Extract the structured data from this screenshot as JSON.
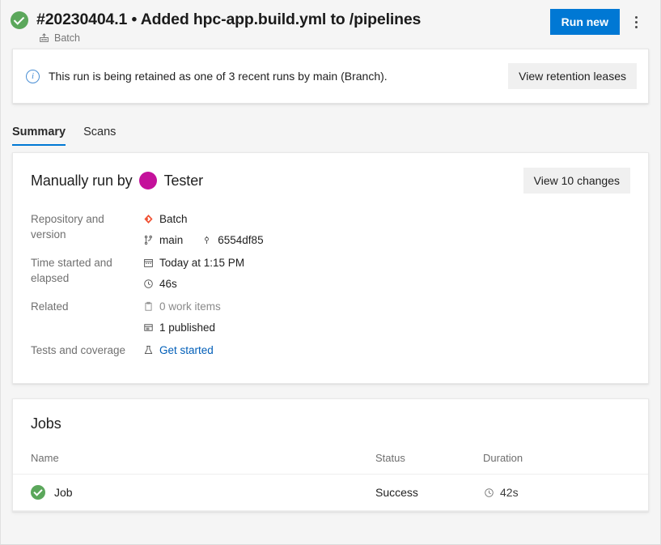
{
  "header": {
    "status_icon": "success-check-icon",
    "title": "#20230404.1 • Added hpc-app.build.yml to /pipelines",
    "pipeline_icon": "pipeline-icon",
    "pipeline_name": "Batch",
    "run_new_label": "Run new",
    "more_actions_icon": "kebab-menu-icon",
    "accent_color": "#0078d4",
    "success_color": "#5ba75b"
  },
  "banner": {
    "icon": "info-icon",
    "message": "This run is being retained as one of 3 recent runs by main (Branch).",
    "action_label": "View retention leases"
  },
  "tabs": [
    {
      "label": "Summary",
      "active": true
    },
    {
      "label": "Scans",
      "active": false
    }
  ],
  "summary": {
    "run_by_prefix": "Manually run by",
    "avatar_icon": "user-avatar",
    "avatar_color": "#c4119b",
    "user_name": "Tester",
    "changes_button_label": "View 10 changes",
    "details": {
      "repository_label": "Repository and version",
      "repository_icon": "azure-repos-icon",
      "repository_name": "Batch",
      "branch_icon": "branch-icon",
      "branch_name": "main",
      "commit_icon": "commit-icon",
      "commit_sha": "6554df85",
      "time_label": "Time started and elapsed",
      "calendar_icon": "calendar-icon",
      "started_at": "Today at 1:15 PM",
      "clock_icon": "clock-icon",
      "elapsed": "46s",
      "related_label": "Related",
      "work_items_icon": "work-item-icon",
      "work_items": "0 work items",
      "artifacts_icon": "artifact-icon",
      "artifacts": "1 published",
      "tests_label": "Tests and coverage",
      "tests_icon": "beaker-icon",
      "tests_link": "Get started"
    }
  },
  "jobs": {
    "title": "Jobs",
    "columns": [
      "Name",
      "Status",
      "Duration"
    ],
    "rows": [
      {
        "status_icon": "success-check-icon",
        "name": "Job",
        "status": "Success",
        "duration_icon": "clock-icon",
        "duration": "42s"
      }
    ]
  }
}
